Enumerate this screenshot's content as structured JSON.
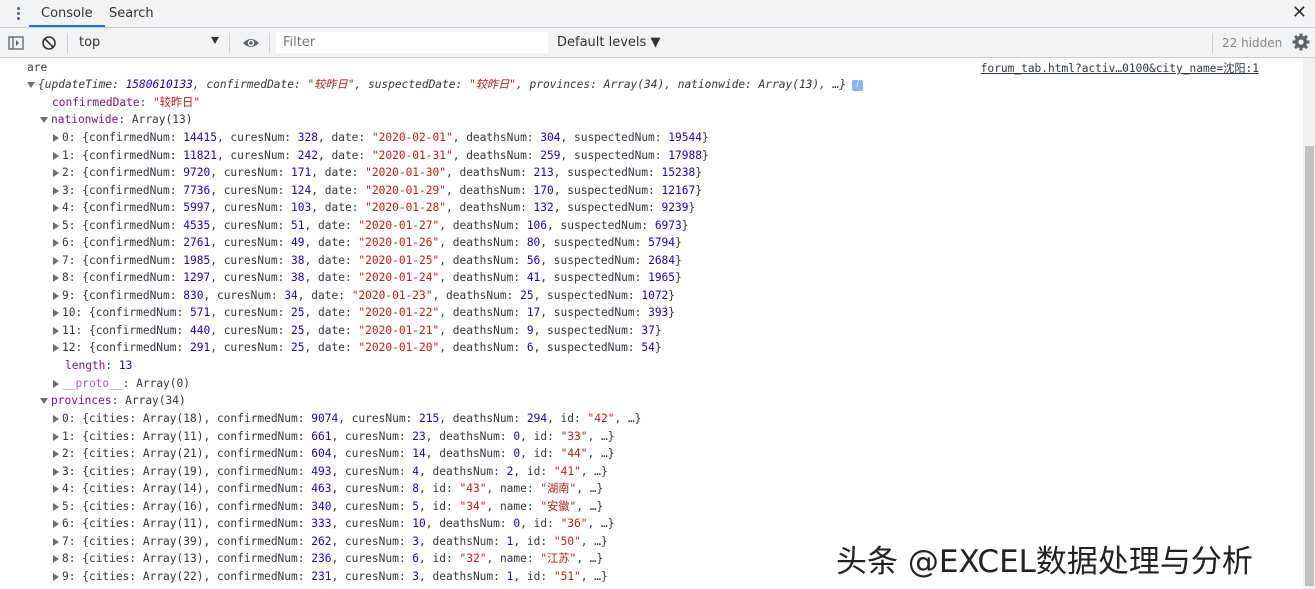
{
  "tabs": [
    "Console",
    "Search"
  ],
  "toolbar": {
    "context": "top",
    "filter_placeholder": "Filter",
    "levels": "Default levels ▼",
    "hidden": "22 hidden"
  },
  "log_label": "are",
  "source_link": "forum_tab.html?activ…0100&city_name=沈阳:1",
  "summary": {
    "prefix": "{updateTime: ",
    "updateTime": "1580610133",
    "confirmedDate": "\"较昨日\"",
    "suspectedDate": "\"较昨日\"",
    "provinces": "Array(34)",
    "nationwide": "Array(13)"
  },
  "confirmedDate_value": "\"较昨日\"",
  "nationwide_header": "Array(13)",
  "nationwide": [
    {
      "i": "0",
      "confirmedNum": "14415",
      "curesNum": "328",
      "date": "\"2020-02-01\"",
      "deathsNum": "304",
      "suspectedNum": "19544"
    },
    {
      "i": "1",
      "confirmedNum": "11821",
      "curesNum": "242",
      "date": "\"2020-01-31\"",
      "deathsNum": "259",
      "suspectedNum": "17988"
    },
    {
      "i": "2",
      "confirmedNum": "9720",
      "curesNum": "171",
      "date": "\"2020-01-30\"",
      "deathsNum": "213",
      "suspectedNum": "15238"
    },
    {
      "i": "3",
      "confirmedNum": "7736",
      "curesNum": "124",
      "date": "\"2020-01-29\"",
      "deathsNum": "170",
      "suspectedNum": "12167"
    },
    {
      "i": "4",
      "confirmedNum": "5997",
      "curesNum": "103",
      "date": "\"2020-01-28\"",
      "deathsNum": "132",
      "suspectedNum": "9239"
    },
    {
      "i": "5",
      "confirmedNum": "4535",
      "curesNum": "51",
      "date": "\"2020-01-27\"",
      "deathsNum": "106",
      "suspectedNum": "6973"
    },
    {
      "i": "6",
      "confirmedNum": "2761",
      "curesNum": "49",
      "date": "\"2020-01-26\"",
      "deathsNum": "80",
      "suspectedNum": "5794"
    },
    {
      "i": "7",
      "confirmedNum": "1985",
      "curesNum": "38",
      "date": "\"2020-01-25\"",
      "deathsNum": "56",
      "suspectedNum": "2684"
    },
    {
      "i": "8",
      "confirmedNum": "1297",
      "curesNum": "38",
      "date": "\"2020-01-24\"",
      "deathsNum": "41",
      "suspectedNum": "1965"
    },
    {
      "i": "9",
      "confirmedNum": "830",
      "curesNum": "34",
      "date": "\"2020-01-23\"",
      "deathsNum": "25",
      "suspectedNum": "1072"
    },
    {
      "i": "10",
      "confirmedNum": "571",
      "curesNum": "25",
      "date": "\"2020-01-22\"",
      "deathsNum": "17",
      "suspectedNum": "393"
    },
    {
      "i": "11",
      "confirmedNum": "440",
      "curesNum": "25",
      "date": "\"2020-01-21\"",
      "deathsNum": "9",
      "suspectedNum": "37"
    },
    {
      "i": "12",
      "confirmedNum": "291",
      "curesNum": "25",
      "date": "\"2020-01-20\"",
      "deathsNum": "6",
      "suspectedNum": "54"
    }
  ],
  "length_value": "13",
  "proto_value": "Array(0)",
  "provinces_header": "Array(34)",
  "provinces": [
    {
      "i": "0",
      "cities": "Array(18)",
      "confirmedNum": "9074",
      "curesNum": "215",
      "k4": "deathsNum",
      "v4": "294",
      "k4s": false,
      "k5": "id",
      "v5": "\"42\""
    },
    {
      "i": "1",
      "cities": "Array(11)",
      "confirmedNum": "661",
      "curesNum": "23",
      "k4": "deathsNum",
      "v4": "0",
      "k4s": false,
      "k5": "id",
      "v5": "\"33\""
    },
    {
      "i": "2",
      "cities": "Array(21)",
      "confirmedNum": "604",
      "curesNum": "14",
      "k4": "deathsNum",
      "v4": "0",
      "k4s": false,
      "k5": "id",
      "v5": "\"44\""
    },
    {
      "i": "3",
      "cities": "Array(19)",
      "confirmedNum": "493",
      "curesNum": "4",
      "k4": "deathsNum",
      "v4": "2",
      "k4s": false,
      "k5": "id",
      "v5": "\"41\""
    },
    {
      "i": "4",
      "cities": "Array(14)",
      "confirmedNum": "463",
      "curesNum": "8",
      "k4": "id",
      "v4": "\"43\"",
      "k4s": true,
      "k5": "name",
      "v5": "\"湖南\""
    },
    {
      "i": "5",
      "cities": "Array(16)",
      "confirmedNum": "340",
      "curesNum": "5",
      "k4": "id",
      "v4": "\"34\"",
      "k4s": true,
      "k5": "name",
      "v5": "\"安徽\""
    },
    {
      "i": "6",
      "cities": "Array(11)",
      "confirmedNum": "333",
      "curesNum": "10",
      "k4": "deathsNum",
      "v4": "0",
      "k4s": false,
      "k5": "id",
      "v5": "\"36\""
    },
    {
      "i": "7",
      "cities": "Array(39)",
      "confirmedNum": "262",
      "curesNum": "3",
      "k4": "deathsNum",
      "v4": "1",
      "k4s": false,
      "k5": "id",
      "v5": "\"50\""
    },
    {
      "i": "8",
      "cities": "Array(13)",
      "confirmedNum": "236",
      "curesNum": "6",
      "k4": "id",
      "v4": "\"32\"",
      "k4s": true,
      "k5": "name",
      "v5": "\"江苏\""
    },
    {
      "i": "9",
      "cities": "Array(22)",
      "confirmedNum": "231",
      "curesNum": "3",
      "k4": "deathsNum",
      "v4": "1",
      "k4s": false,
      "k5": "id",
      "v5": "\"51\""
    }
  ],
  "watermark": "头条 @EXCEL数据处理与分析"
}
